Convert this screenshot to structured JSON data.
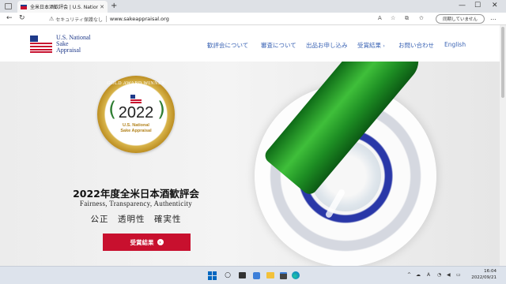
{
  "browser": {
    "tab_title": "全米日本酒歓評会 | U.S. Nationa",
    "tab_close": "✕",
    "new_tab": "+",
    "insecure_label": "セキュリティ保護なし",
    "url": "www.sakeappraisal.org",
    "sync_button": "同期していません",
    "back_icon": "←",
    "refresh_icon": "↻",
    "more_icon": "…",
    "read_aloud_icon": "A",
    "favorite_icon": "☆",
    "collections_icon": "⧉",
    "min_icon": "—",
    "max_icon": "☐",
    "close_icon": "✕"
  },
  "site": {
    "logo_lines": [
      "U.S. National",
      "Sake",
      "Appraisal"
    ],
    "nav": [
      "歓評会について",
      "審査について",
      "出品お申し込み",
      "受賞結果",
      "お問い合わせ",
      "English"
    ],
    "nav_chevron": "›"
  },
  "hero": {
    "badge_arc": "GOLD AWARD WINNER",
    "badge_year": "2022",
    "badge_org_1": "U.S. National",
    "badge_org_2": "Sake Appraisal",
    "title": "2022年度全米日本酒歓評会",
    "subtitle": "Fairness, Transparency, Authenticity",
    "keywords": "公正　透明性　確実性",
    "cta_label": "受賞結果",
    "cta_icon": "›"
  },
  "taskbar": {
    "time": "16:04",
    "date": "2022/09/21",
    "search_icon": "○",
    "chevron_icon": "^",
    "cloud_icon": "☁",
    "ime_indicator": "A",
    "wifi_icon": "◔",
    "volume_icon": "◀",
    "battery_icon": "▭"
  },
  "colors": {
    "brand_blue": "#1f3a8a",
    "brand_red": "#c8102e",
    "nav_blue": "#3a63b4",
    "gold": "#b98a1e"
  }
}
